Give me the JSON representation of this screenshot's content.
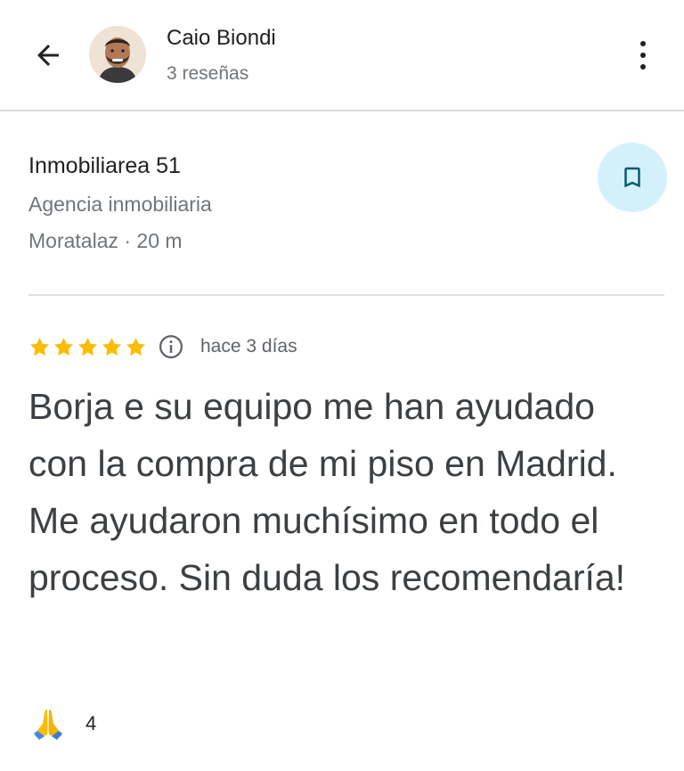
{
  "header": {
    "back_icon": "arrow-left-icon",
    "user_name": "Caio Biondi",
    "user_reviews": "3 reseñas",
    "more_icon": "more-vertical-icon"
  },
  "place": {
    "name": "Inmobiliarea 51",
    "category": "Agencia inmobiliaria",
    "location": "Moratalaz · 20 m",
    "save_icon": "bookmark-icon"
  },
  "review": {
    "rating": 5,
    "rating_max": 5,
    "date": "hace 3 días",
    "text": "Borja e su equipo me han ayudado con la compra de mi piso en Madrid. Me ayudaron muchísimo en todo el proceso. Sin duda los recomendaría!"
  },
  "reaction": {
    "icon": "folded-hands-icon",
    "count": "4"
  },
  "colors": {
    "star": "#fbbc04",
    "save_bg": "#d3f1fb",
    "save_icon": "#0b5a6b",
    "secondary_text": "#70757a"
  }
}
